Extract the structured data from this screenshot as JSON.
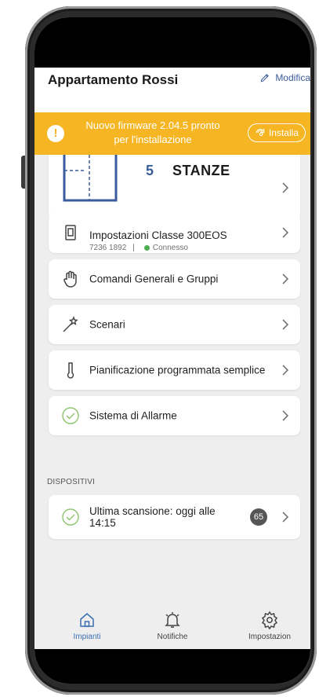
{
  "header": {
    "title": "Appartamento Rossi",
    "edit_label": "Modifica"
  },
  "banner": {
    "message": "Nuovo firmware 2.04.5 pronto per l'installazione",
    "install_label": "Installa",
    "color": "#f6b624"
  },
  "rooms": {
    "count": "5",
    "label": "STANZE"
  },
  "menu": {
    "settings_title": "Impostazioni Classe 300EOS",
    "settings_id": "7236 1892",
    "settings_sep": "|",
    "settings_status": "Connesso",
    "commands": "Comandi Generali e Gruppi",
    "scenarios": "Scenari",
    "schedule": "Pianificazione programmata semplice",
    "alarm": "Sistema di Allarme"
  },
  "devices": {
    "section_title": "DISPOSITIVI",
    "last_scan": "Ultima scansione: oggi alle 14:15",
    "count": "65"
  },
  "tabs": [
    {
      "label": "Impianti",
      "icon": "home-icon",
      "active": true
    },
    {
      "label": "Notifiche",
      "icon": "bell-icon",
      "active": false
    },
    {
      "label": "Impostazion",
      "icon": "gear-icon",
      "active": false
    }
  ],
  "colors": {
    "accent": "#3b5c9c",
    "status_ok": "#4caf50",
    "check": "#8cc46b"
  }
}
